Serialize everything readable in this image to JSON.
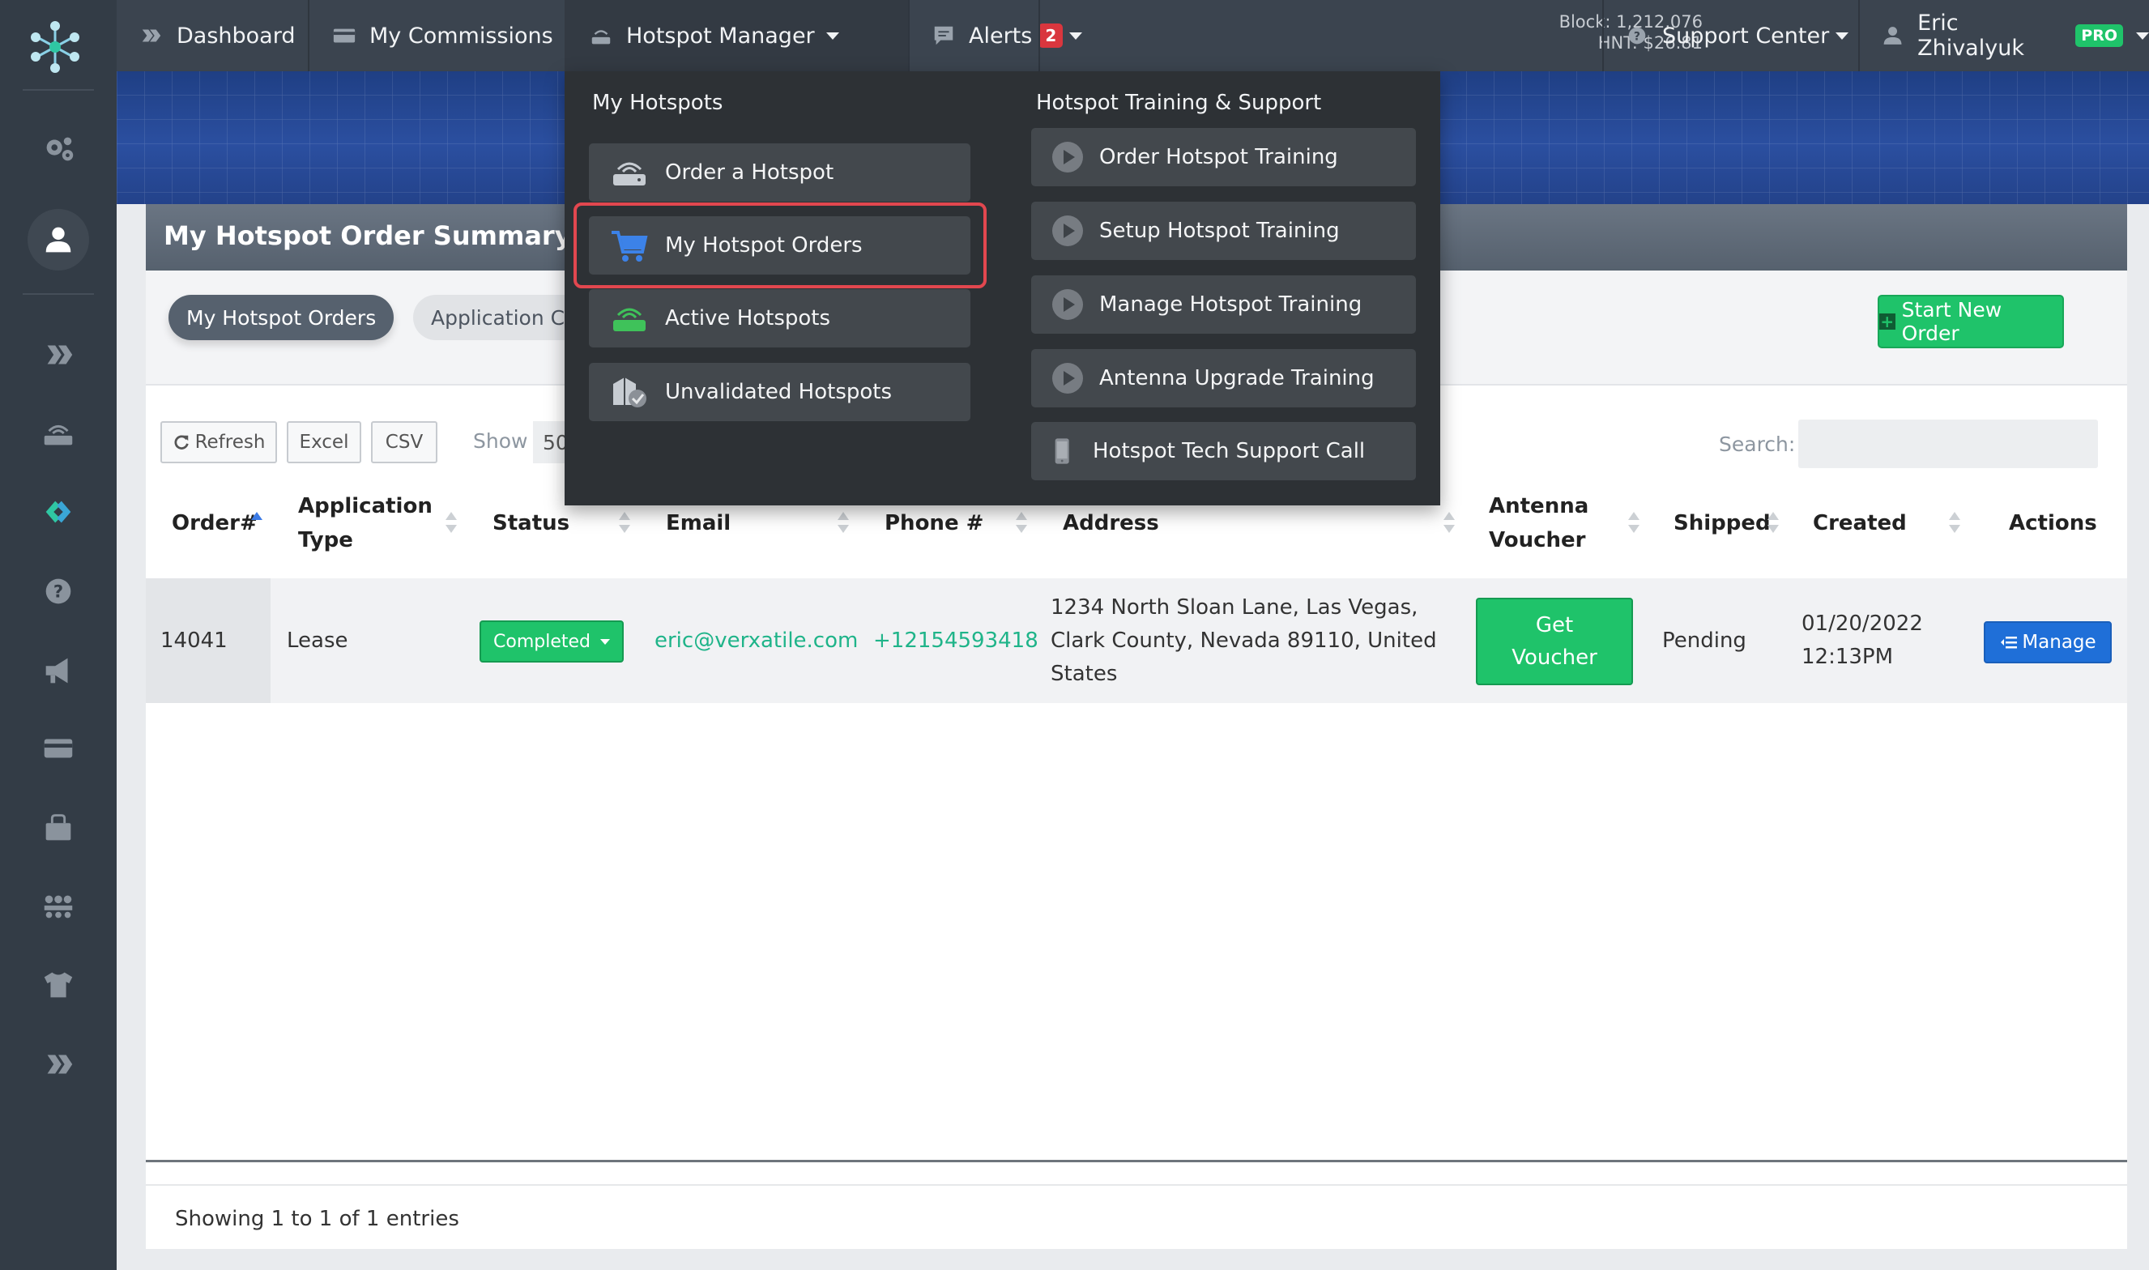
{
  "nav": {
    "dashboard": "Dashboard",
    "commissions": "My Commissions",
    "hotspot_manager": "Hotspot Manager",
    "alerts": "Alerts",
    "alerts_count": "2",
    "block": "Block: 1,212,076",
    "hnt": "HNT: $26.81",
    "support": "Support Center",
    "user": "Eric Zhivalyuk",
    "pro": "PRO"
  },
  "sidebar": {
    "icons": [
      "logo-icon",
      "gears-icon",
      "user-icon",
      "helium-icon",
      "router-icon",
      "brand-icon",
      "help-icon",
      "megaphone-icon",
      "card-icon",
      "store-icon",
      "team-icon",
      "shirt-icon",
      "helium-icon-2"
    ]
  },
  "card": {
    "title": "My Hotspot Order Summary",
    "tab_active": "My Hotspot Orders",
    "tab_inactive": "Application Co",
    "start_order": "Start New Order"
  },
  "tools": {
    "refresh": "Refresh",
    "excel": "Excel",
    "csv": "CSV",
    "show": "Show",
    "show_value": "50",
    "search_label": "Search:"
  },
  "table": {
    "headers": {
      "order": "Order#",
      "app_type_1": "Application",
      "app_type_2": "Type",
      "status": "Status",
      "email": "Email",
      "phone": "Phone #",
      "address": "Address",
      "voucher_1": "Antenna",
      "voucher_2": "Voucher",
      "shipped": "Shipped",
      "created": "Created",
      "actions": "Actions"
    },
    "rows": [
      {
        "order": "14041",
        "type": "Lease",
        "status": "Completed",
        "email": "eric@verxatile.com",
        "phone": "+12154593418",
        "address_1": "1234 North Sloan Lane, Las Vegas,",
        "address_2": "Clark County, Nevada 89110, United",
        "address_3": "States",
        "voucher_1": "Get",
        "voucher_2": "Voucher",
        "shipped": "Pending",
        "created_date": "01/20/2022",
        "created_time": "12:13PM",
        "action": "Manage"
      }
    ],
    "info": "Showing 1 to 1 of 1 entries"
  },
  "dropdown": {
    "left_heading": "My Hotspots",
    "right_heading": "Hotspot Training & Support",
    "left_items": [
      "Order a Hotspot",
      "My Hotspot Orders",
      "Active Hotspots",
      "Unvalidated Hotspots"
    ],
    "right_items": [
      "Order Hotspot Training",
      "Setup Hotspot Training",
      "Manage Hotspot Training",
      "Antenna Upgrade Training",
      "Hotspot Tech Support Call"
    ]
  },
  "colors": {
    "accent_green": "#1fc36a",
    "link_teal": "#1fb489",
    "manage_blue": "#1f6fd8",
    "highlight_red": "#e2474f",
    "nav_bg": "#3b444f",
    "dropdown_bg": "#2d3135"
  }
}
